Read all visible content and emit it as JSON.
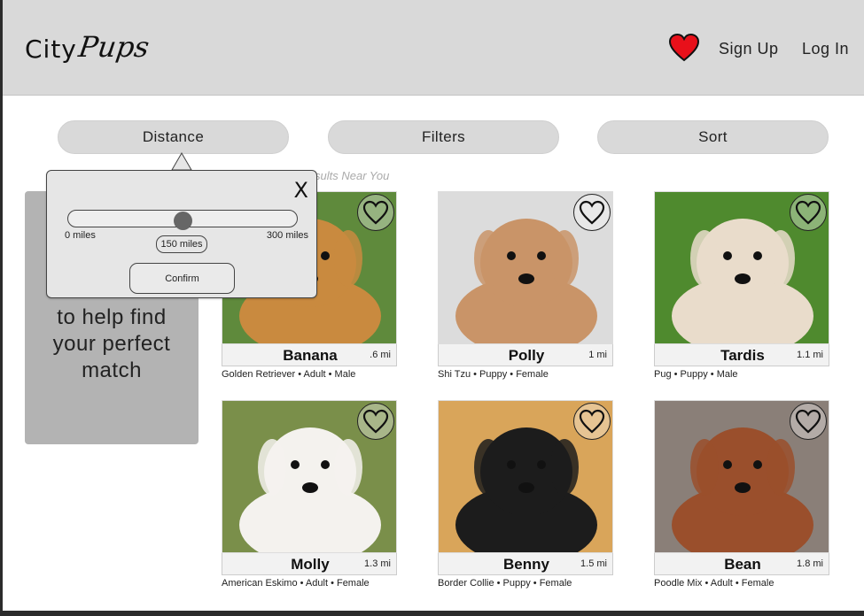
{
  "header": {
    "logo_city": "City",
    "logo_pups": "Pups",
    "favorites_icon": "heart-icon",
    "favorites_color": "#e8101a",
    "signup_label": "Sign Up",
    "login_label": "Log In"
  },
  "toolbar": {
    "distance_label": "Distance",
    "filters_label": "Filters",
    "sort_label": "Sort"
  },
  "sidebar": {
    "line1": "to help find",
    "line2": "your perfect",
    "line3": "match"
  },
  "results_label": "sults Near You",
  "distance_popover": {
    "close_label": "X",
    "min_label": "0 miles",
    "max_label": "300 miles",
    "min_value": 0,
    "max_value": 300,
    "selected_value": 150,
    "selected_label": "150 miles",
    "confirm_label": "Confirm"
  },
  "dogs": [
    {
      "name": "Banana",
      "distance": ".6 mi",
      "description": "Golden Retriever • Adult • Male",
      "coat_color": "#c98a3f",
      "bg_color": "#5f8a3c"
    },
    {
      "name": "Polly",
      "distance": "1 mi",
      "description": "Shi Tzu • Puppy • Female",
      "coat_color": "#c99468",
      "bg_color": "#dcdcdc"
    },
    {
      "name": "Tardis",
      "distance": "1.1 mi",
      "description": "Pug • Puppy • Male",
      "coat_color": "#e9dccb",
      "bg_color": "#4f8a2e"
    },
    {
      "name": "Molly",
      "distance": "1.3 mi",
      "description": "American Eskimo • Adult • Female",
      "coat_color": "#f4f2ee",
      "bg_color": "#7a8f4a"
    },
    {
      "name": "Benny",
      "distance": "1.5 mi",
      "description": "Border Collie • Puppy • Female",
      "coat_color": "#1c1c1c",
      "bg_color": "#d9a55a"
    },
    {
      "name": "Bean",
      "distance": "1.8 mi",
      "description": "Poodle Mix • Adult • Female",
      "coat_color": "#9a4f2c",
      "bg_color": "#8a7f78"
    }
  ]
}
